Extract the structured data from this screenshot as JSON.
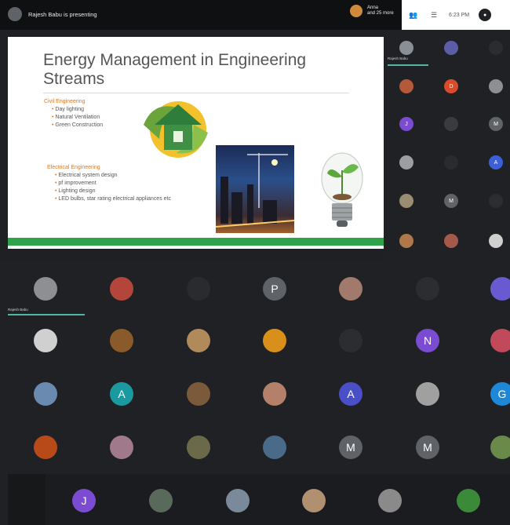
{
  "header": {
    "presenting": "Rajesh Babu is presenting",
    "others_name": "Anna",
    "others_more": "and 25 more",
    "time": "6:23 PM"
  },
  "slide": {
    "title_line1": "Energy Management in Engineering",
    "title_line2": "Streams",
    "civil": {
      "heading": "Civil Engineering",
      "items": [
        "Day lighting",
        "Natural Ventilation",
        "Green Construction"
      ]
    },
    "electrical": {
      "heading": "Electrical Engineering",
      "items": [
        "Electrical system design",
        "pf improvement",
        "Lighting design",
        "LED bulbs, star rating electrical appliances etc"
      ]
    }
  },
  "self_label": "Rajesh Babu",
  "right_tiles": [
    {
      "letter": "",
      "color": "#8a8f96"
    },
    {
      "letter": "",
      "color": "#5b5ea6"
    },
    {
      "letter": "",
      "color": "#2b2c2f"
    },
    {
      "letter": "",
      "color": "#b45a3a"
    },
    {
      "letter": "D",
      "color": "#d84c2b"
    },
    {
      "letter": "",
      "color": "#8d8f93"
    },
    {
      "letter": "J",
      "color": "#7b4bd1"
    },
    {
      "letter": "",
      "color": "#3a3b3e"
    },
    {
      "letter": "M",
      "color": "#5f6368"
    },
    {
      "letter": "",
      "color": "#9c9ea3"
    },
    {
      "letter": "",
      "color": "#2a2b2e"
    },
    {
      "letter": "A",
      "color": "#3c5fd8"
    },
    {
      "letter": "",
      "color": "#9a8c70"
    },
    {
      "letter": "M",
      "color": "#5f6368"
    },
    {
      "letter": "",
      "color": "#2c2d30"
    },
    {
      "letter": "",
      "color": "#b0784a"
    },
    {
      "letter": "",
      "color": "#a35a4a"
    },
    {
      "letter": "",
      "color": "#cfcfcf"
    }
  ],
  "main_tiles": [
    {
      "letter": "",
      "color": "#8d8f93"
    },
    {
      "letter": "",
      "color": "#b3453a"
    },
    {
      "letter": "",
      "color": "#2a2b2e"
    },
    {
      "letter": "P",
      "color": "#5f6368"
    },
    {
      "letter": "",
      "color": "#a27a6b"
    },
    {
      "letter": "",
      "color": "#2c2d30"
    },
    {
      "letter": "",
      "color": "#6a5ad1"
    },
    {
      "letter": "",
      "color": "#d0d0d0"
    },
    {
      "letter": "",
      "color": "#8a5a2a"
    },
    {
      "letter": "",
      "color": "#b08a5a"
    },
    {
      "letter": "",
      "color": "#d8901a"
    },
    {
      "letter": "",
      "color": "#2c2d30"
    },
    {
      "letter": "N",
      "color": "#7b4bd1"
    },
    {
      "letter": "",
      "color": "#c04a5a"
    },
    {
      "letter": "",
      "color": "#6a8ab0"
    },
    {
      "letter": "A",
      "color": "#1a9aa0"
    },
    {
      "letter": "",
      "color": "#7a5a3a"
    },
    {
      "letter": "",
      "color": "#b4806a"
    },
    {
      "letter": "A",
      "color": "#4a4fc8"
    },
    {
      "letter": "",
      "color": "#a0a0a0"
    },
    {
      "letter": "G",
      "color": "#1e88d8"
    },
    {
      "letter": "",
      "color": "#b84a1a"
    },
    {
      "letter": "",
      "color": "#a07a8a"
    },
    {
      "letter": "",
      "color": "#6a6a4a"
    },
    {
      "letter": "",
      "color": "#4a6a8a"
    },
    {
      "letter": "M",
      "color": "#5f6368"
    },
    {
      "letter": "M",
      "color": "#5f6368"
    },
    {
      "letter": "",
      "color": "#6a8a4a"
    },
    {
      "letter": "J",
      "color": "#7b4bd1"
    },
    {
      "letter": "",
      "color": "#5a6a5a"
    },
    {
      "letter": "",
      "color": "#7a8a9a"
    },
    {
      "letter": "",
      "color": "#b09070"
    },
    {
      "letter": "",
      "color": "#8a8a8a"
    },
    {
      "letter": "",
      "color": "#3a8a3a"
    }
  ]
}
